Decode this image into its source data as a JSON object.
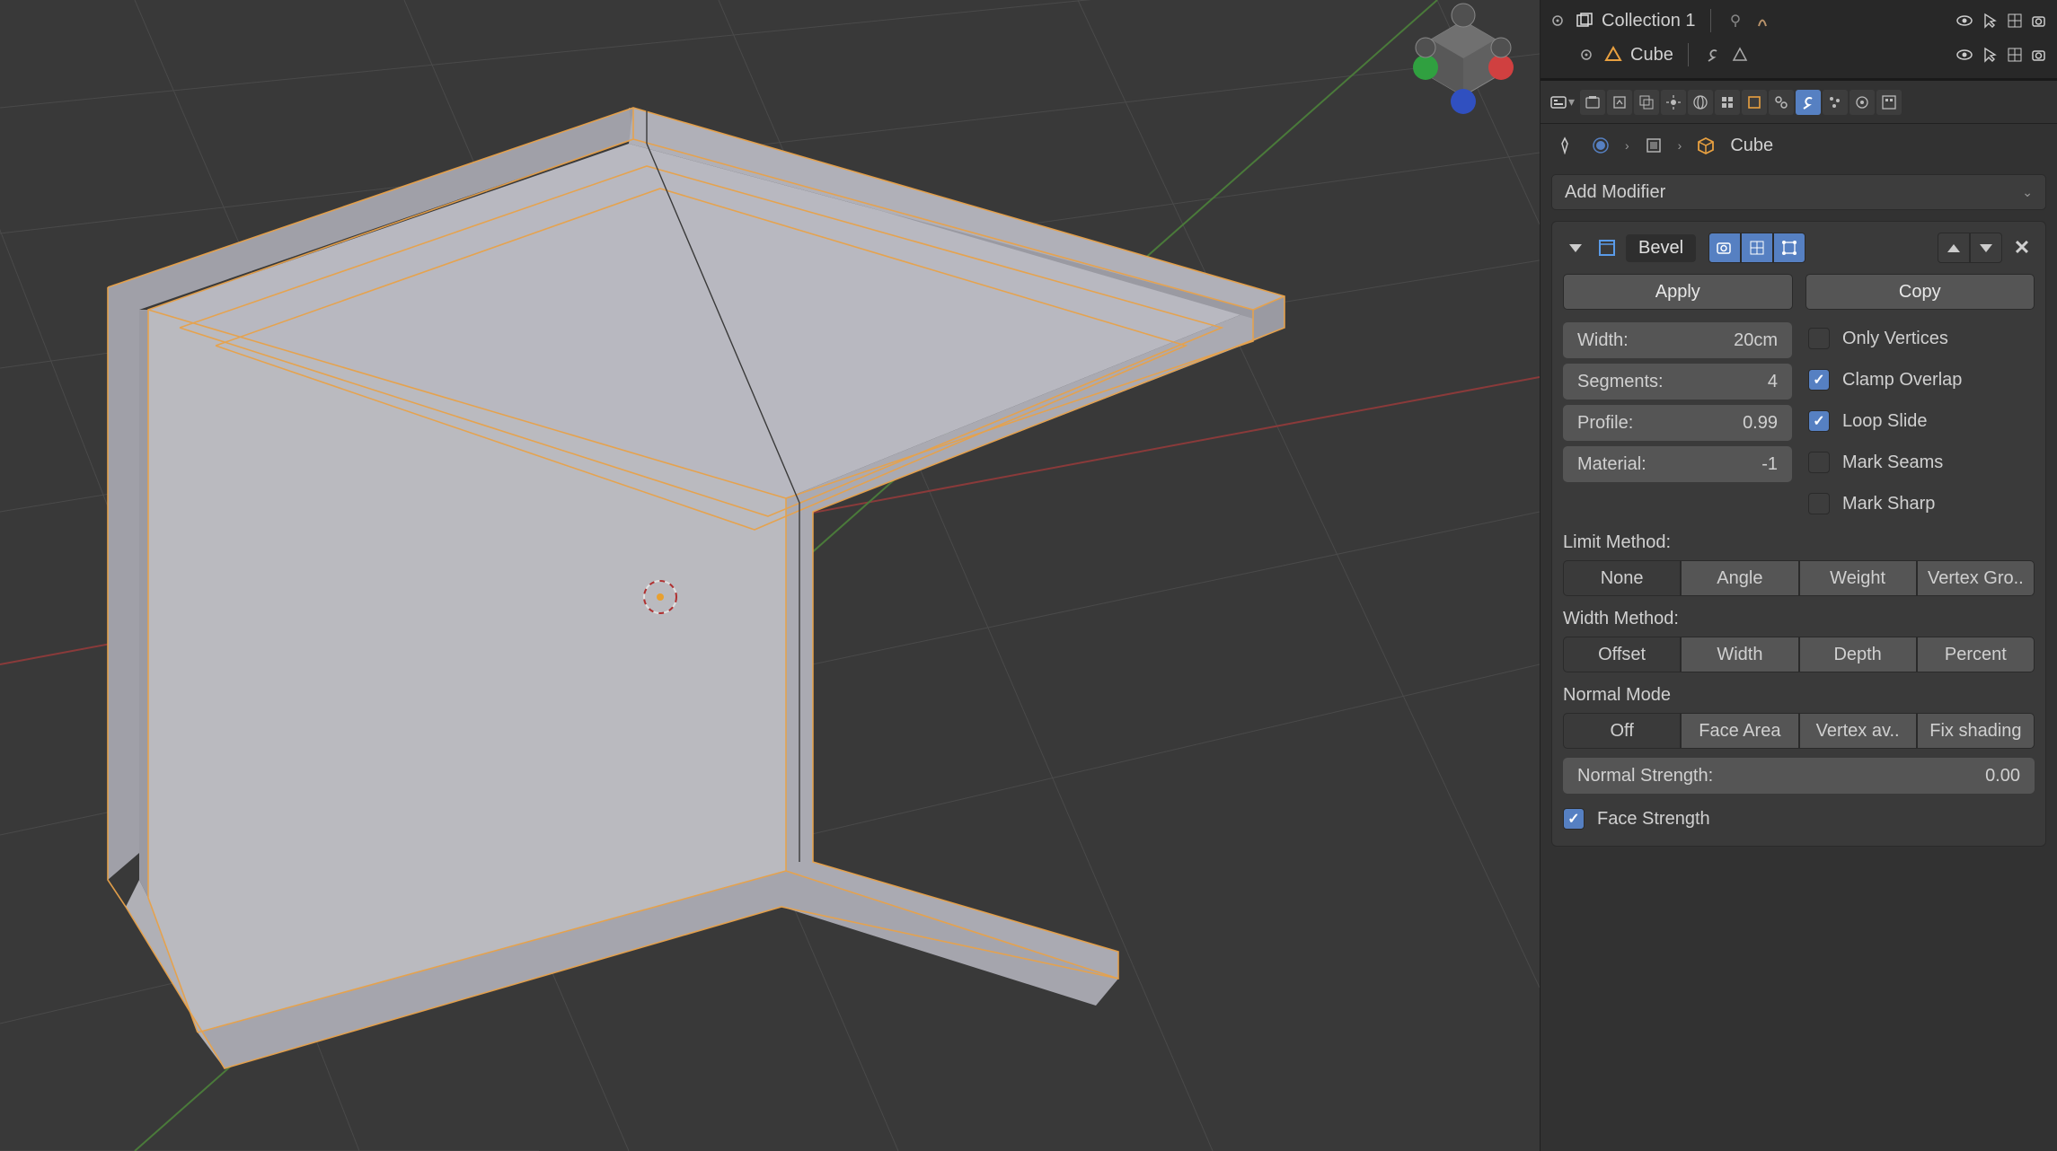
{
  "outliner": {
    "collection": "Collection 1",
    "object": "Cube"
  },
  "breadcrumb": {
    "object": "Cube"
  },
  "modifier_dropdown": "Add Modifier",
  "modifier": {
    "name": "Bevel",
    "apply_btn": "Apply",
    "copy_btn": "Copy",
    "fields": {
      "width_label": "Width:",
      "width_value": "20cm",
      "segments_label": "Segments:",
      "segments_value": "4",
      "profile_label": "Profile:",
      "profile_value": "0.99",
      "material_label": "Material:",
      "material_value": "-1"
    },
    "checks": {
      "only_vertices": "Only Vertices",
      "clamp_overlap": "Clamp Overlap",
      "loop_slide": "Loop Slide",
      "mark_seams": "Mark Seams",
      "mark_sharp": "Mark Sharp"
    },
    "limit_label": "Limit Method:",
    "limit": [
      "None",
      "Angle",
      "Weight",
      "Vertex Gro.."
    ],
    "width_method_label": "Width Method:",
    "width_method": [
      "Offset",
      "Width",
      "Depth",
      "Percent"
    ],
    "normal_mode_label": "Normal Mode",
    "normal_mode": [
      "Off",
      "Face Area",
      "Vertex av..",
      "Fix shading"
    ],
    "normal_strength_label": "Normal Strength:",
    "normal_strength_value": "0.00",
    "face_strength": "Face Strength"
  }
}
